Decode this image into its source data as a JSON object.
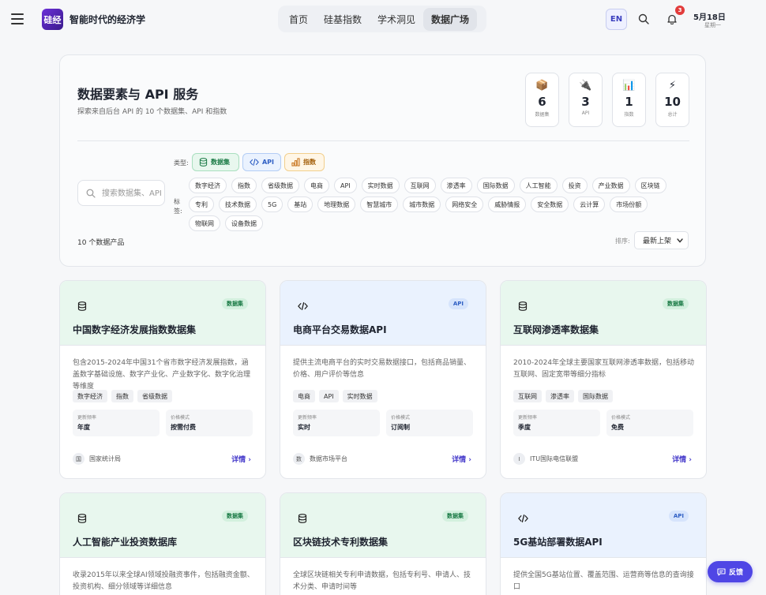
{
  "header": {
    "logo_text": "硅经",
    "brand": "智能时代的经济学",
    "nav": [
      {
        "label": "首页",
        "active": false
      },
      {
        "label": "硅基指数",
        "active": false
      },
      {
        "label": "学术洞见",
        "active": false
      },
      {
        "label": "数据广场",
        "active": true
      }
    ],
    "lang": "EN",
    "notifications": "3",
    "date": "5月18日",
    "weekday": "星期一"
  },
  "panel": {
    "title": "数据要素与 API 服务",
    "subtitle": "探索来自后台 API 的 10 个数据集、API 和指数",
    "stats": [
      {
        "icon": "📦",
        "value": "6",
        "label": "数据集"
      },
      {
        "icon": "🔌",
        "value": "3",
        "label": "API"
      },
      {
        "icon": "📊",
        "value": "1",
        "label": "指数"
      },
      {
        "icon": "⚡",
        "value": "10",
        "label": "总计"
      }
    ],
    "search_placeholder": "搜索数据集、API、指数",
    "type_label": "类型:",
    "types": [
      {
        "label": "数据集",
        "icon": "database-icon"
      },
      {
        "label": "API",
        "icon": "code-icon"
      },
      {
        "label": "指数",
        "icon": "chart-icon"
      }
    ],
    "tag_label": "标签:",
    "tags": [
      "数字经济",
      "指数",
      "省级数据",
      "电商",
      "API",
      "实时数据",
      "互联网",
      "渗透率",
      "国际数据",
      "人工智能",
      "投资",
      "产业数据",
      "区块链",
      "专利",
      "技术数据",
      "5G",
      "基站",
      "地理数据",
      "智慧城市",
      "城市数据",
      "网络安全",
      "威胁情报",
      "安全数据",
      "云计算",
      "市场份额",
      "物联网",
      "设备数据"
    ],
    "count_text": "10 个数据产品",
    "sort_label": "排序:",
    "sort_value": "最新上架"
  },
  "colors": {
    "dataset_bg": "#e8f7ee",
    "dataset_badge": "#d3f0de",
    "dataset_text": "#1a7a45",
    "api_bg": "#eaf2fe",
    "api_badge": "#d6e4fc",
    "api_text": "#2f5fc4",
    "accent": "#4f46e5"
  },
  "cards": [
    {
      "type": "数据集",
      "kind": "dataset",
      "title": "中国数字经济发展指数数据集",
      "desc": "包含2015-2024年中国31个省市数字经济发展指数，涵盖数字基础设施、数字产业化、产业数字化、数字化治理等维度",
      "tags": [
        "数字经济",
        "指数",
        "省级数据"
      ],
      "freq_label": "更新频率",
      "freq": "年度",
      "price_label": "价格模式",
      "price": "按需付费",
      "avatar": "国",
      "publisher": "国家统计局",
      "detail": "详情"
    },
    {
      "type": "API",
      "kind": "api",
      "title": "电商平台交易数据API",
      "desc": "提供主流电商平台的实时交易数据接口，包括商品销量、价格、用户评价等信息",
      "tags": [
        "电商",
        "API",
        "实时数据"
      ],
      "freq_label": "更新频率",
      "freq": "实时",
      "price_label": "价格模式",
      "price": "订阅制",
      "avatar": "数",
      "publisher": "数据市场平台",
      "detail": "详情"
    },
    {
      "type": "数据集",
      "kind": "dataset",
      "title": "互联网渗透率数据集",
      "desc": "2010-2024年全球主要国家互联网渗透率数据，包括移动互联网、固定宽带等细分指标",
      "tags": [
        "互联网",
        "渗透率",
        "国际数据"
      ],
      "freq_label": "更新频率",
      "freq": "季度",
      "price_label": "价格模式",
      "price": "免费",
      "avatar": "I",
      "publisher": "ITU国际电信联盟",
      "detail": "详情"
    },
    {
      "type": "数据集",
      "kind": "dataset",
      "title": "人工智能产业投资数据库",
      "desc": "收录2015年以来全球AI领域投融资事件，包括融资金额、投资机构、细分领域等详细信息",
      "tags": [],
      "avatar": "",
      "publisher": "",
      "detail": ""
    },
    {
      "type": "数据集",
      "kind": "dataset",
      "title": "区块链技术专利数据集",
      "desc": "全球区块链相关专利申请数据，包括专利号、申请人、技术分类、申请时间等",
      "tags": [],
      "avatar": "",
      "publisher": "",
      "detail": ""
    },
    {
      "type": "API",
      "kind": "api",
      "title": "5G基站部署数据API",
      "desc": "提供全国5G基站位置、覆盖范围、运营商等信息的查询接口",
      "tags": [],
      "avatar": "",
      "publisher": "",
      "detail": ""
    }
  ],
  "feedback": "反馈"
}
